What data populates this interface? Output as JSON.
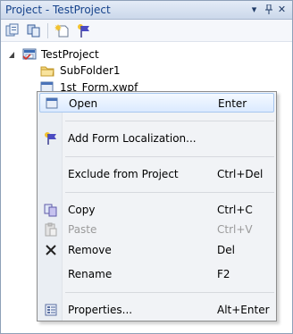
{
  "window": {
    "title": "Project - TestProject"
  },
  "titlebar_buttons": {
    "dropdown": "▾",
    "pin": "ᵖ",
    "close": "✕"
  },
  "tree": {
    "root": "TestProject",
    "folder": "SubFolder1",
    "file": "1st_Form.xwpf"
  },
  "menu": {
    "items": [
      {
        "label": "Open",
        "shortcut": "Enter",
        "icon": "open-icon"
      },
      {
        "label": "Add Form Localization...",
        "shortcut": "",
        "icon": "flag-icon"
      },
      {
        "label": "Exclude from Project",
        "shortcut": "Ctrl+Del",
        "icon": ""
      },
      {
        "label": "Copy",
        "shortcut": "Ctrl+C",
        "icon": "copy-icon"
      },
      {
        "label": "Paste",
        "shortcut": "Ctrl+V",
        "icon": "paste-icon",
        "disabled": true
      },
      {
        "label": "Remove",
        "shortcut": "Del",
        "icon": "remove-icon"
      },
      {
        "label": "Rename",
        "shortcut": "F2",
        "icon": ""
      },
      {
        "label": "Properties...",
        "shortcut": "Alt+Enter",
        "icon": "properties-icon"
      }
    ]
  },
  "colors": {
    "title_text": "#15428b",
    "highlight_border": "#a7c7ef",
    "disabled_text": "#9a9a9a"
  }
}
